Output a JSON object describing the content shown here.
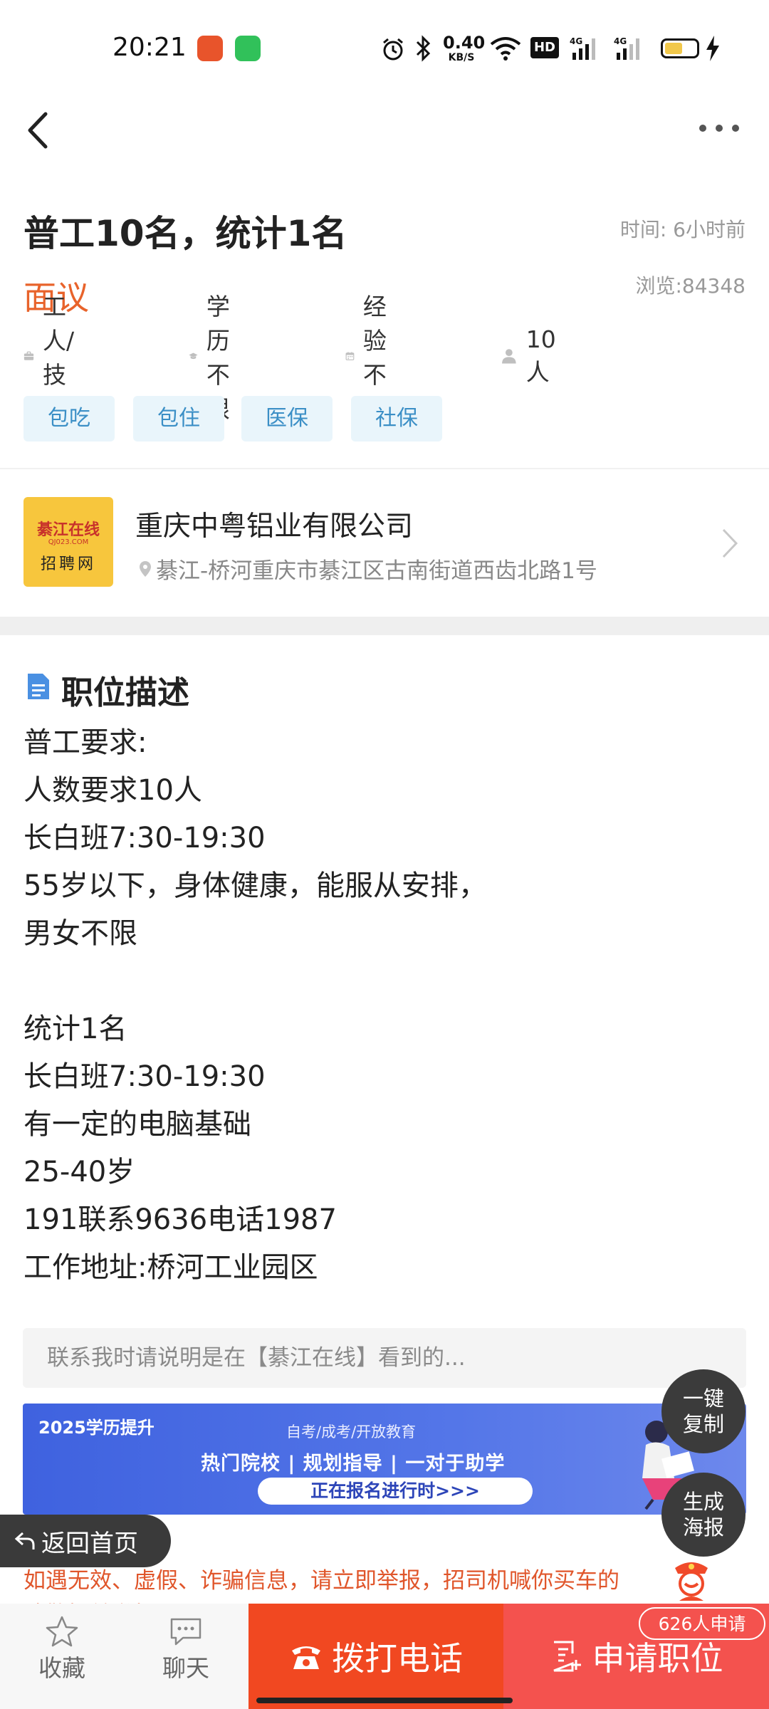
{
  "status_bar": {
    "time": "20:21",
    "net_speed": "0.40",
    "net_speed_unit": "KB/S",
    "hd_badge": "HD",
    "icons": [
      "app-icon-orange",
      "app-icon-green",
      "alarm-icon",
      "bluetooth-icon",
      "wifi-icon",
      "hd-icon",
      "signal-4g-icon",
      "signal-4g-icon",
      "battery-icon",
      "charging-icon"
    ]
  },
  "nav": {
    "icons": [
      "back-icon",
      "more-icon"
    ]
  },
  "job": {
    "title": "普工10名，统计1名",
    "time_label": "时间: 6小时前",
    "salary": "面议",
    "views": "浏览:84348",
    "meta": [
      {
        "icon": "briefcase-icon",
        "text": "工人/技工"
      },
      {
        "icon": "graduation-cap-icon",
        "text": "学历 不限"
      },
      {
        "icon": "calendar-icon",
        "text": "经验 不限"
      },
      {
        "icon": "person-icon",
        "text": "10人"
      }
    ],
    "tags": [
      "包吃",
      "包住",
      "医保",
      "社保"
    ]
  },
  "company": {
    "logo": {
      "top": "綦江在线",
      "mid": "QJ023.COM",
      "bottom": "招聘网"
    },
    "name": "重庆中粤铝业有限公司",
    "address": "綦江-桥河重庆市綦江区古南街道西齿北路1号"
  },
  "description": {
    "title": "职位描述",
    "lines": [
      "普工要求:",
      "人数要求10人",
      "长白班7:30-19:30",
      "55岁以下，身体健康，能服从安排，",
      "男女不限",
      "",
      "统计1名",
      "长白班7:30-19:30",
      "有一定的电脑基础",
      "25-40岁",
      "191联系9636电话1987",
      "工作地址:桥河工业园区"
    ],
    "contact_note": "联系我时请说明是在【綦江在线】看到的..."
  },
  "ad": {
    "tag": "2025学历提升",
    "sub": "自考/成考/开放教育",
    "main": "热门院校 | 规划指导 | 一对于助学",
    "button": "正在报名进行时>>>"
  },
  "floating": {
    "copy_line1": "一键",
    "copy_line2": "复制",
    "poster_line1": "生成",
    "poster_line2": "海报",
    "home": "返回首页"
  },
  "warning": "如遇无效、虚假、诈骗信息，请立即举报，招司机喊你买车的请警惕并举报！",
  "bottom_bar": {
    "favorite": "收藏",
    "chat": "聊天",
    "call": "拨打电话",
    "apply": "申请职位",
    "applicants": "626人申请"
  },
  "colors": {
    "salary": "#e8632b",
    "tag_bg": "#e9f5fb",
    "tag_text": "#3b8fc6",
    "call_bg": "#f14821",
    "apply_bg": "#f4524e",
    "warning": "#e0562b",
    "ad_bg": "#4a6ae4"
  }
}
